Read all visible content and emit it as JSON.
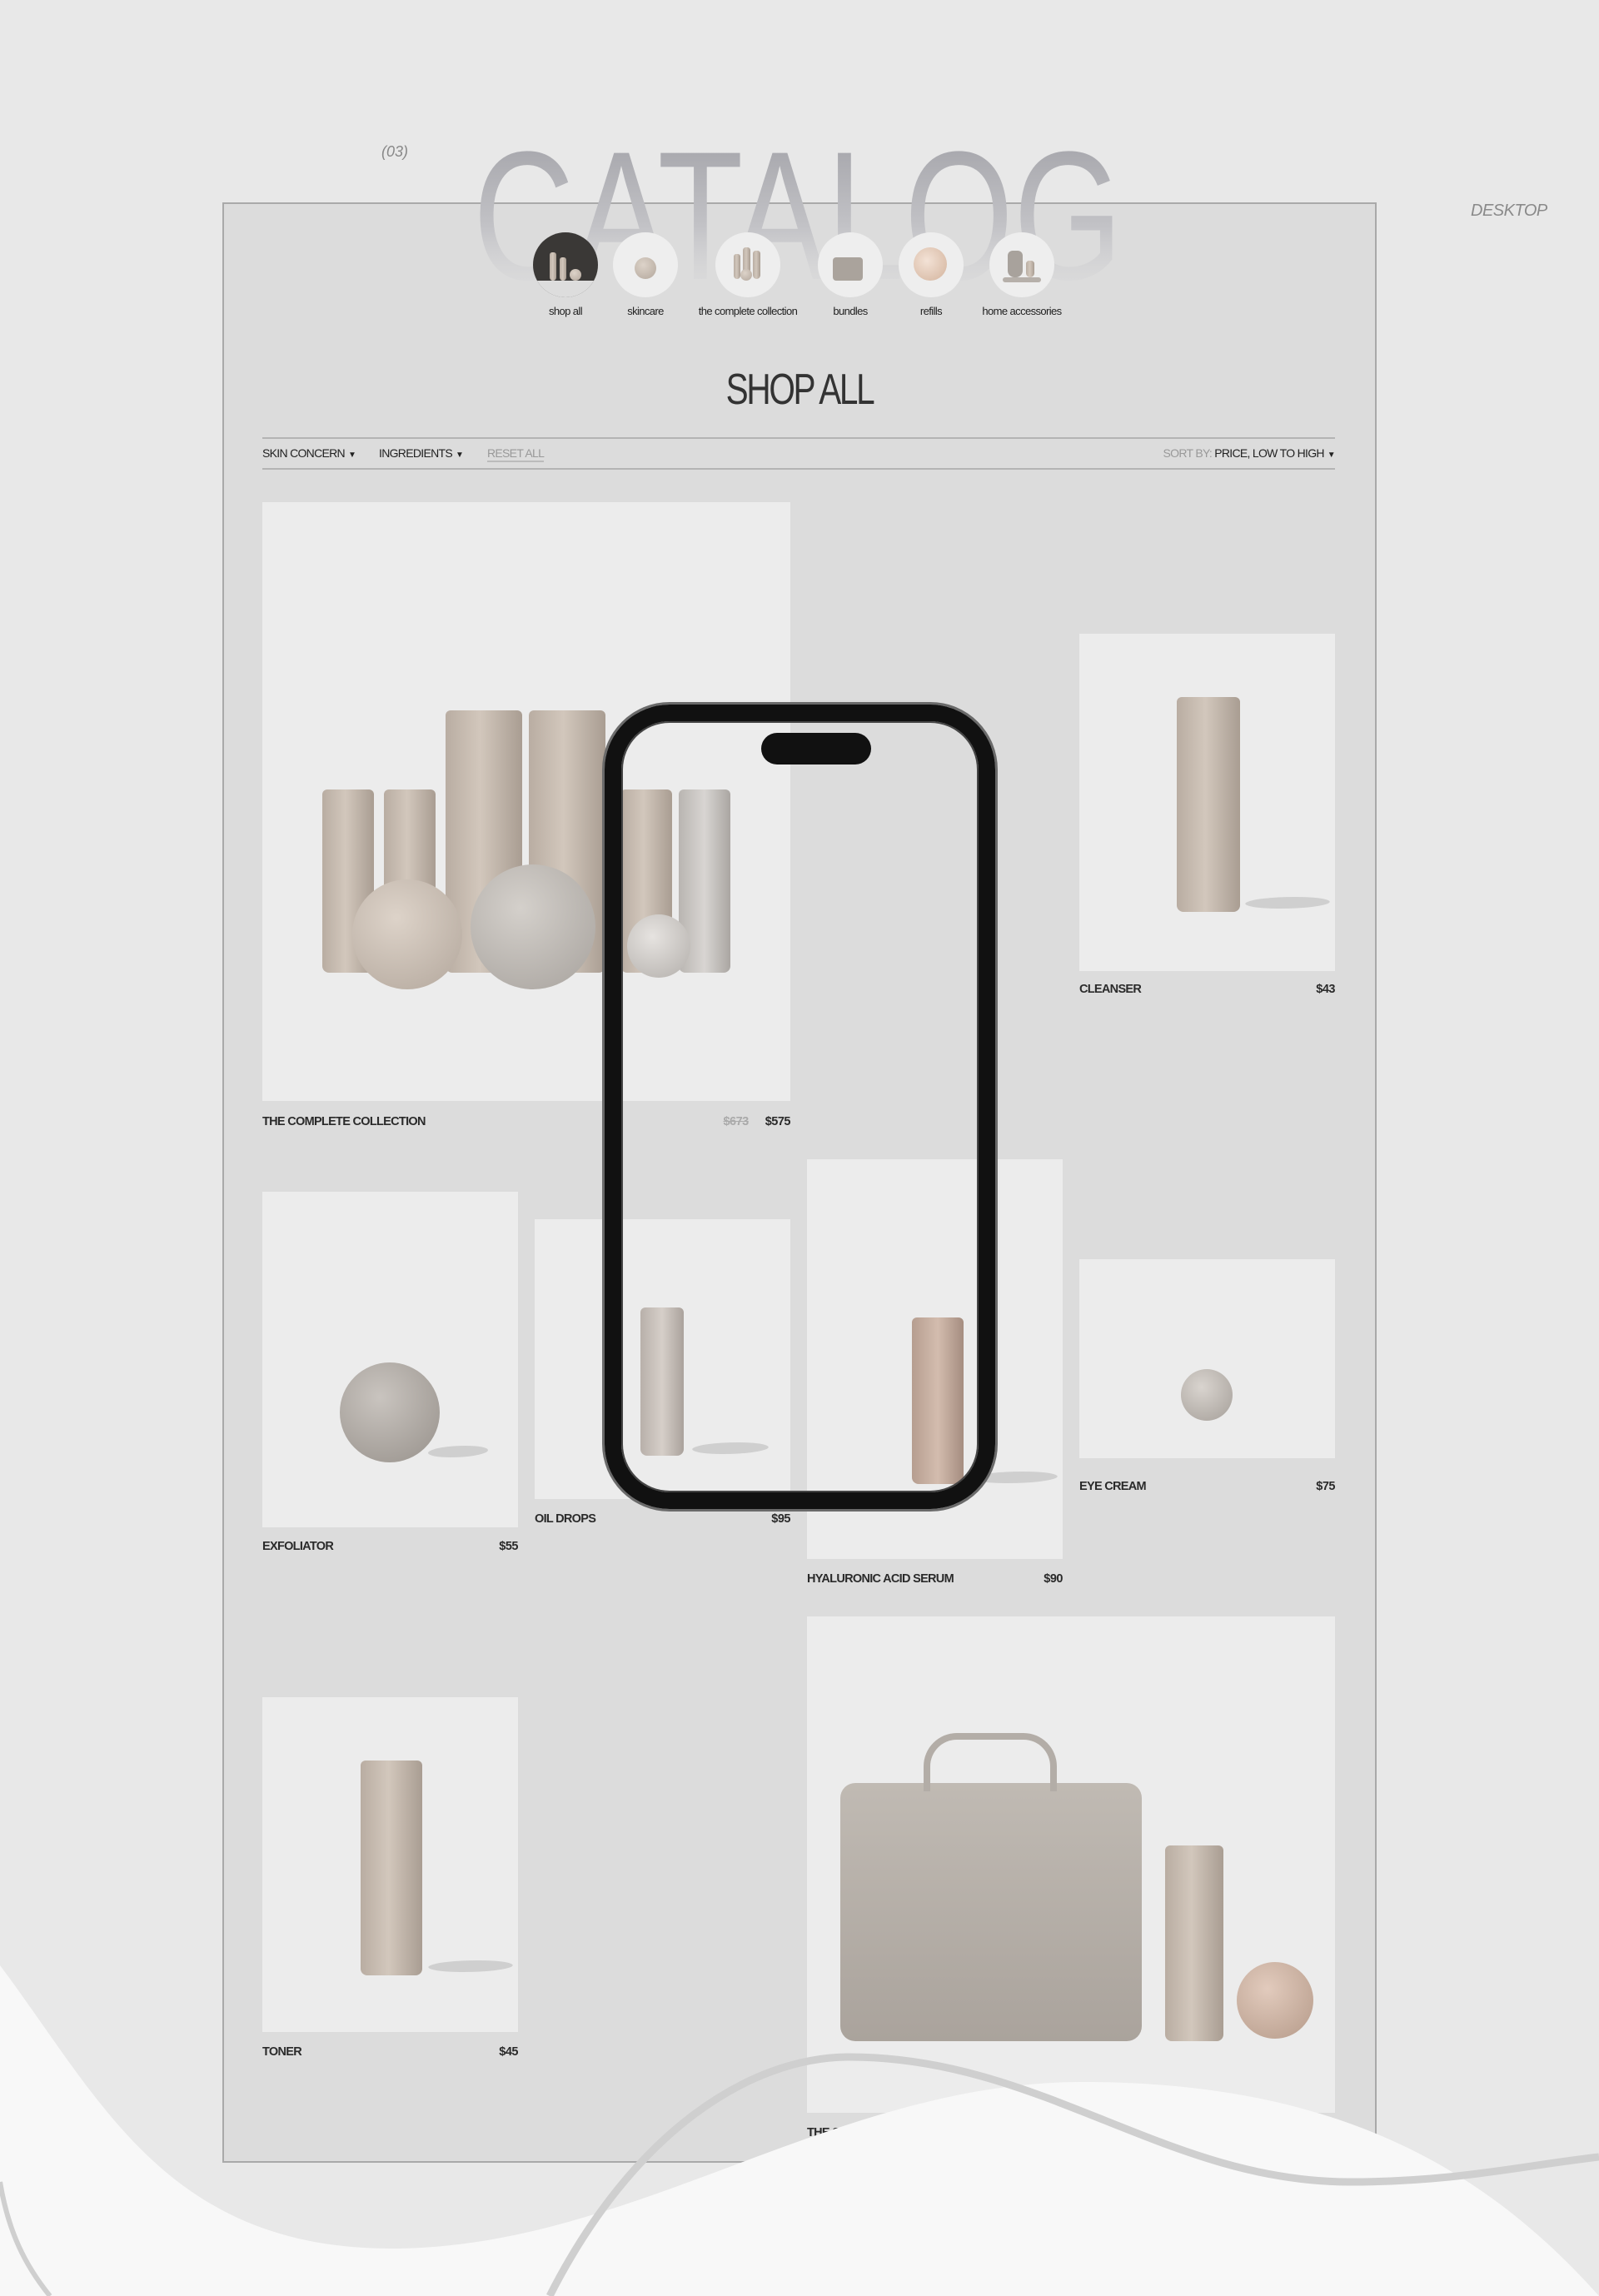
{
  "section_index": "(03)",
  "headline": "CATALOG",
  "viewport_label": "DESKTOP",
  "categories": [
    {
      "label": "shop all",
      "active": true
    },
    {
      "label": "skincare"
    },
    {
      "label": "the complete collection"
    },
    {
      "label": "bundles"
    },
    {
      "label": "refills"
    },
    {
      "label": "home accessories"
    }
  ],
  "page_title": "SHOP ALL",
  "filters": {
    "skin_concern": "SKIN CONCERN",
    "ingredients": "INGREDIENTS",
    "reset": "RESET ALL",
    "sort_label": "SORT BY:",
    "sort_value": "PRICE, LOW TO HIGH",
    "dropdown_icon": "triangle-down"
  },
  "products": [
    {
      "name": "THE COMPLETE COLLECTION",
      "old_price": "$673",
      "price": "$575"
    },
    {
      "name": "CLEANSER",
      "price": "$43"
    },
    {
      "name": "EXFOLIATOR",
      "price": "$55"
    },
    {
      "name": "OIL DROPS",
      "price": "$95"
    },
    {
      "name": "HYALURONIC ACID SERUM",
      "price": "$90"
    },
    {
      "name": "EYE CREAM",
      "price": "$75"
    },
    {
      "name": "TONER",
      "price": "$45"
    },
    {
      "name": "THE STARTER BUNDLE"
    }
  ],
  "colors": {
    "background": "#e8e8e8",
    "frame": "#dcdcdc",
    "card": "#ececec",
    "product": "#c2b6ab"
  }
}
